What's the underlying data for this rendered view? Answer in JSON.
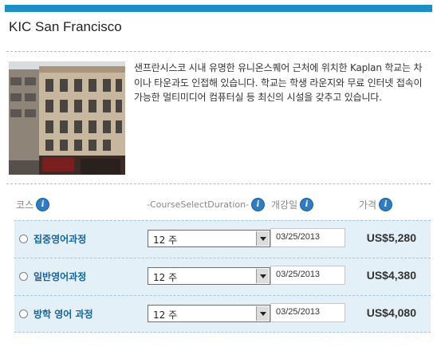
{
  "header": {
    "title": "KIC San Francisco",
    "accent_color": "#1a8fc8"
  },
  "intro": {
    "photo": "school-building-photo",
    "description": "샌프란시스코 시내 유명한 유니온스퀘어 근처에 위치한 Kaplan 학교는 차이나 타운과도 인접해 있습니다. 학교는 학생 라운지와 무료 인터넷 접속이 가능한 멀티미디어 컴퓨터실 등 최신의 시설을 갖추고 있습니다."
  },
  "table": {
    "columns": {
      "course": "코스",
      "duration": "-CourseSelectDuration-",
      "start_date": "개강일",
      "price": "가격"
    },
    "info_icon_glyph": "i",
    "rows": [
      {
        "course": "집중영어과정",
        "duration": "12 주",
        "start_date": "03/25/2013",
        "price": "US$5,280"
      },
      {
        "course": "일반영어과정",
        "duration": "12 주",
        "start_date": "03/25/2013",
        "price": "US$4,380"
      },
      {
        "course": "방학 영어 과정",
        "duration": "12 주",
        "start_date": "03/25/2013",
        "price": "US$4,080"
      }
    ]
  }
}
